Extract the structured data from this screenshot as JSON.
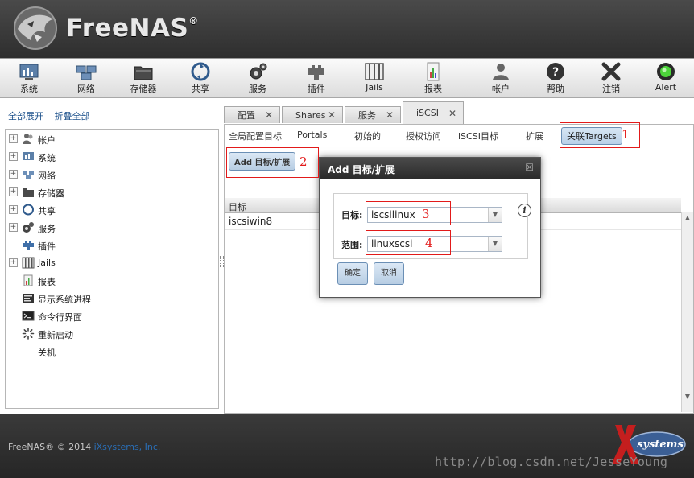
{
  "header": {
    "app_name": "FreeNAS",
    "trademark": "®"
  },
  "toolbar": [
    {
      "label": "系统",
      "icon": "system-icon"
    },
    {
      "label": "网络",
      "icon": "network-icon"
    },
    {
      "label": "存储器",
      "icon": "storage-icon"
    },
    {
      "label": "共享",
      "icon": "sharing-icon"
    },
    {
      "label": "服务",
      "icon": "services-icon"
    },
    {
      "label": "插件",
      "icon": "plugins-icon"
    },
    {
      "label": "Jails",
      "icon": "jails-icon"
    },
    {
      "label": "报表",
      "icon": "reporting-icon"
    },
    {
      "label": "帐户",
      "icon": "account-icon"
    },
    {
      "label": "帮助",
      "icon": "help-icon"
    },
    {
      "label": "注销",
      "icon": "logout-icon"
    },
    {
      "label": "Alert",
      "icon": "alert-icon",
      "status_color": "#4cd43a"
    }
  ],
  "sidebar": {
    "expand_all": "全部展开",
    "collapse_all": "折叠全部",
    "items": [
      {
        "label": "帐户",
        "expandable": true
      },
      {
        "label": "系统",
        "expandable": true
      },
      {
        "label": "网络",
        "expandable": true
      },
      {
        "label": "存储器",
        "expandable": true
      },
      {
        "label": "共享",
        "expandable": true
      },
      {
        "label": "服务",
        "expandable": true
      },
      {
        "label": "插件",
        "expandable": false
      },
      {
        "label": "Jails",
        "expandable": true
      },
      {
        "label": "报表",
        "expandable": false
      },
      {
        "label": "显示系统进程",
        "expandable": false
      },
      {
        "label": "命令行界面",
        "expandable": false
      },
      {
        "label": "重新启动",
        "expandable": false
      },
      {
        "label": "关机",
        "expandable": false
      }
    ]
  },
  "tabs": [
    {
      "label": "配置"
    },
    {
      "label": "Shares"
    },
    {
      "label": "服务"
    },
    {
      "label": "iSCSI",
      "active": true
    }
  ],
  "subtabs": [
    {
      "label": "全局配置目标"
    },
    {
      "label": "Portals"
    },
    {
      "label": "初始的"
    },
    {
      "label": "授权访问"
    },
    {
      "label": "iSCSI目标"
    },
    {
      "label": "扩展"
    },
    {
      "label": "关联Targets",
      "active": true
    }
  ],
  "add_button": "Add 目标/扩展",
  "grid": {
    "header": "目标",
    "rows": [
      "iscsiwin8"
    ]
  },
  "dialog": {
    "title": "Add 目标/扩展",
    "close_symbol": "☒",
    "target_label": "目标:",
    "target_value": "iscsilinux",
    "extent_label": "范围:",
    "extent_value": "linuxscsi",
    "ok_label": "确定",
    "cancel_label": "取消"
  },
  "annotations": {
    "n1": "1",
    "n2": "2",
    "n3": "3",
    "n4": "4",
    "color": "#e21a1a"
  },
  "footer": {
    "copyright": "FreeNAS® © 2014",
    "company": "iXsystems, Inc.",
    "logo_text": "systems"
  },
  "watermark": "http://blog.csdn.net/JesseYoung"
}
